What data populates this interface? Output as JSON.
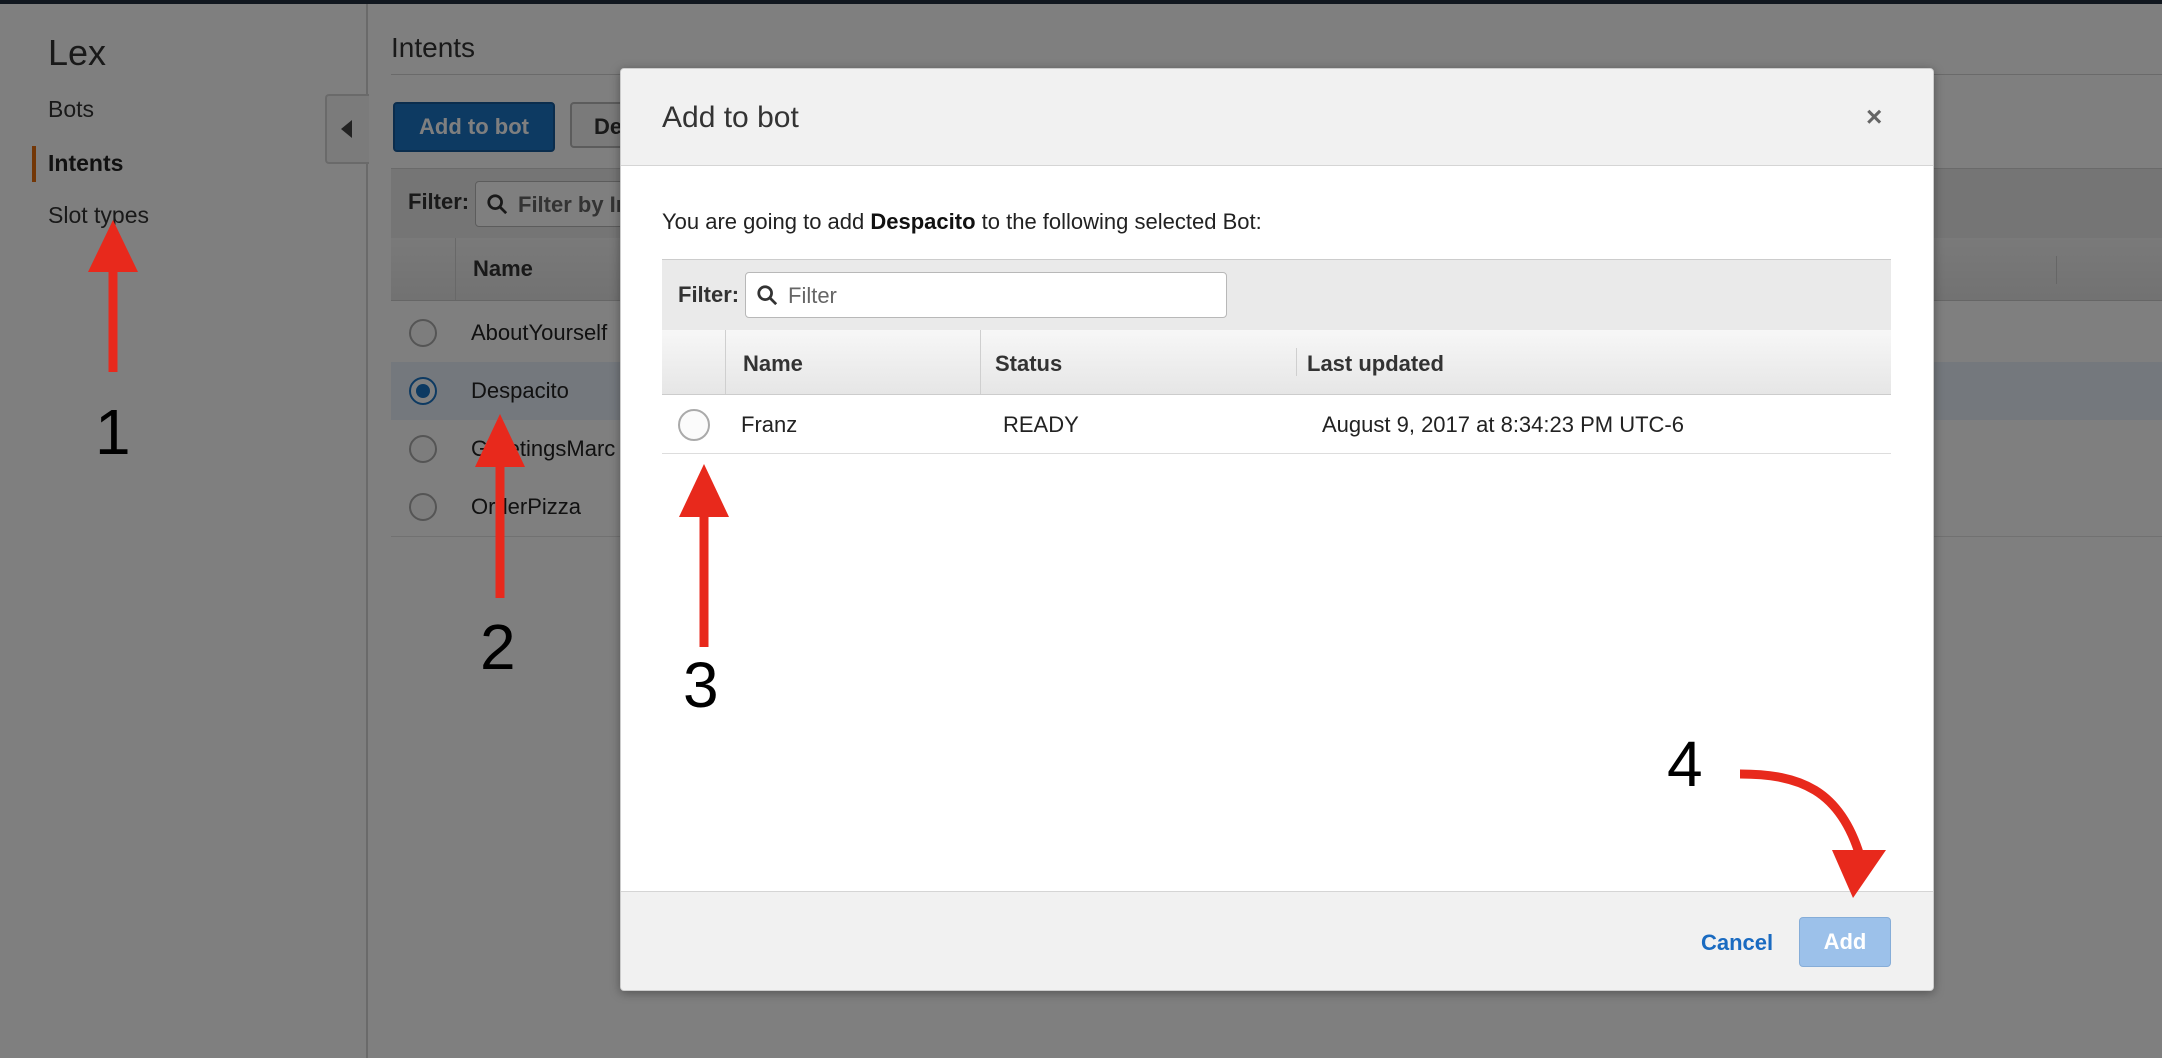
{
  "sidebar": {
    "title": "Lex",
    "items": [
      {
        "label": "Bots"
      },
      {
        "label": "Intents"
      },
      {
        "label": "Slot types"
      }
    ]
  },
  "main": {
    "title": "Intents",
    "add_to_bot_label": "Add to bot",
    "secondary_button_partial": "De",
    "filter_label": "Filter:",
    "filter_placeholder": "Filter by In",
    "column_name": "Name",
    "rows": [
      {
        "name": "AboutYourself",
        "selected": false
      },
      {
        "name": "Despacito",
        "selected": true
      },
      {
        "name": "GreetingsMarc",
        "selected": false
      },
      {
        "name": "OrderPizza",
        "selected": false
      }
    ]
  },
  "modal": {
    "title": "Add to bot",
    "close_symbol": "×",
    "message_prefix": "You are going to add ",
    "message_intent": "Despacito",
    "message_suffix": " to the following selected Bot:",
    "filter_label": "Filter:",
    "filter_placeholder": "Filter",
    "columns": {
      "name": "Name",
      "status": "Status",
      "last_updated": "Last updated"
    },
    "rows": [
      {
        "name": "Franz",
        "status": "READY",
        "last_updated": "August 9, 2017 at 8:34:23 PM UTC-6",
        "selected": false
      }
    ],
    "cancel_label": "Cancel",
    "add_label": "Add"
  },
  "annotations": {
    "step_numbers": [
      "1",
      "2",
      "3",
      "4"
    ],
    "arrow_color": "#e8291c"
  },
  "colors": {
    "primary": "#1b74c5",
    "active_marker": "#e76e0e",
    "add_disabled": "#9cc1ea"
  }
}
